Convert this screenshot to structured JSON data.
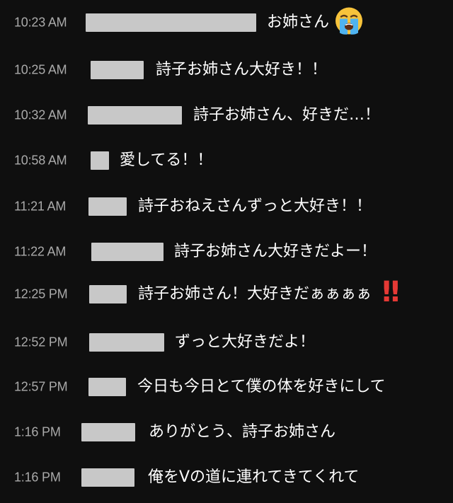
{
  "chat": {
    "messages": [
      {
        "time": "10:23 AM",
        "text": "お姉さん",
        "emoji": "loudly-crying-face-emoji"
      },
      {
        "time": "10:25 AM",
        "text": "詩子お姉さん大好き！！"
      },
      {
        "time": "10:32 AM",
        "text": "詩子お姉さん、好きだ…！"
      },
      {
        "time": "10:58 AM",
        "text": "愛してる！！"
      },
      {
        "time": "11:21 AM",
        "text": "詩子おねえさんずっと大好き！！"
      },
      {
        "time": "11:22 AM",
        "text": "詩子お姉さん大好きだよー！"
      },
      {
        "time": "12:25 PM",
        "text": "詩子お姉さん！大好きだぁぁぁぁ",
        "emoji": "double-exclamation-mark-emoji",
        "emoji_glyph": "!!"
      },
      {
        "time": "12:52 PM",
        "text": "ずっと大好きだよ！"
      },
      {
        "time": "12:57 PM",
        "text": "今日も今日とて僕の体を好きにして"
      },
      {
        "time": "1:16 PM",
        "text": "ありがとう、詩子お姉さん"
      },
      {
        "time": "1:16 PM",
        "text": "俺をVの道に連れてきてくれて"
      }
    ]
  },
  "colors": {
    "background": "#0f0f0f",
    "timestamp": "#aaaaaa",
    "message_text": "#ffffff",
    "redacted_author": "#c8c8c8",
    "exclamation_emoji": "#e53935"
  }
}
